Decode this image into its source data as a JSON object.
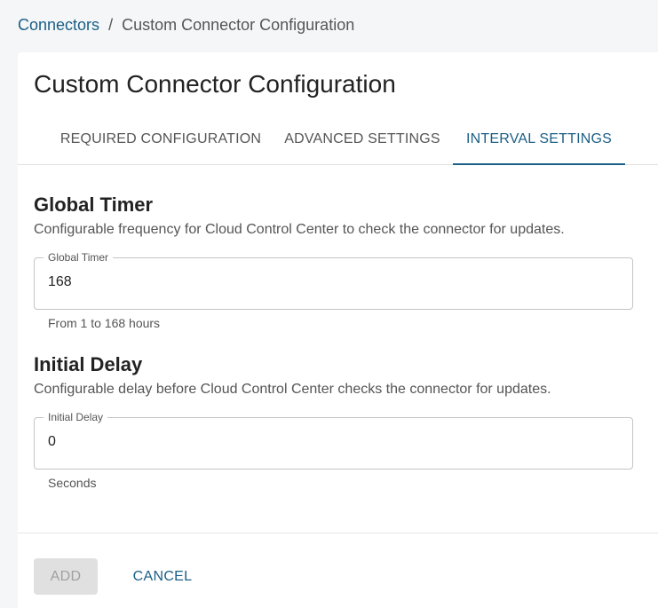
{
  "breadcrumb": {
    "parent": "Connectors",
    "separator": "/",
    "current": "Custom Connector Configuration"
  },
  "page": {
    "title": "Custom Connector Configuration"
  },
  "tabs": [
    {
      "label": "REQUIRED CONFIGURATION",
      "active": false
    },
    {
      "label": "ADVANCED SETTINGS",
      "active": false
    },
    {
      "label": "INTERVAL SETTINGS",
      "active": true
    }
  ],
  "global_timer": {
    "heading": "Global Timer",
    "description": "Configurable frequency for Cloud Control Center to check the connector for updates.",
    "field_label": "Global Timer",
    "value": "168",
    "helper": "From 1 to 168 hours"
  },
  "initial_delay": {
    "heading": "Initial Delay",
    "description": "Configurable delay before Cloud Control Center checks the connector for updates.",
    "field_label": "Initial Delay",
    "value": "0",
    "helper": "Seconds"
  },
  "footer": {
    "add_label": "ADD",
    "add_disabled": true,
    "cancel_label": "CANCEL"
  },
  "colors": {
    "accent": "#1b5f86",
    "background": "#f4f6f8",
    "card": "#ffffff",
    "disabled_button": "#e0e0e0"
  }
}
